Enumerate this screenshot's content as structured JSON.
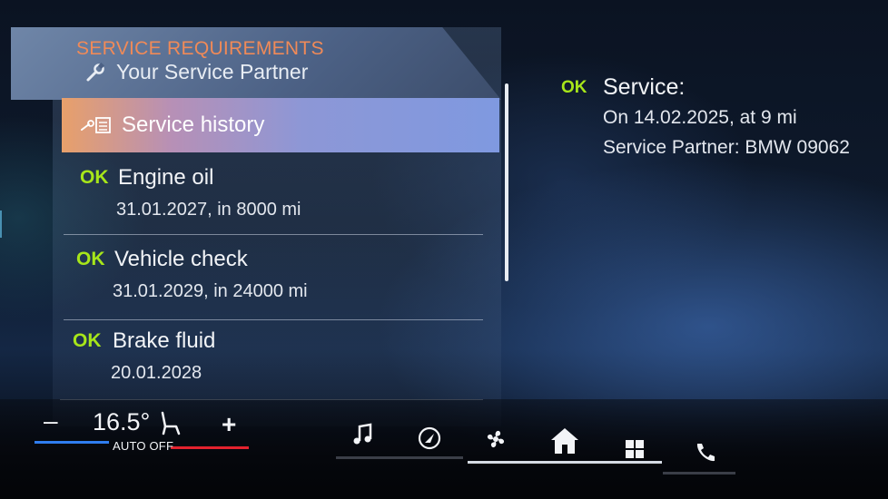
{
  "header": {
    "title": "SERVICE REQUIREMENTS",
    "subtitle": "Your Service Partner",
    "subtitle_icon": "wrench-icon"
  },
  "menu": {
    "selected": {
      "label": "Service history",
      "icon": "service-history-icon"
    },
    "items": [
      {
        "status": "OK",
        "name": "Engine oil",
        "date": "31.01.2027, in 8000 mi"
      },
      {
        "status": "OK",
        "name": "Vehicle check",
        "date": "31.01.2029, in 24000 mi"
      },
      {
        "status": "OK",
        "name": "Brake fluid",
        "date": "20.01.2028"
      }
    ]
  },
  "detail": {
    "status": "OK",
    "title": "Service:",
    "line1": "On 14.02.2025, at 9 mi",
    "line2": "Service Partner: BMW 09062"
  },
  "climate": {
    "minus_label": "–",
    "temperature": "16.5°",
    "plus_label": "+",
    "mode": "AUTO OFF"
  },
  "nav": [
    "music-icon",
    "navigation-icon",
    "fan-icon",
    "home-icon",
    "apps-grid-icon",
    "phone-icon"
  ],
  "colors": {
    "ok_green": "#a7e61a",
    "header_orange": "#f08a58",
    "selection_gradient_start": "#e8a06a",
    "selection_gradient_end": "#7f99e0"
  }
}
